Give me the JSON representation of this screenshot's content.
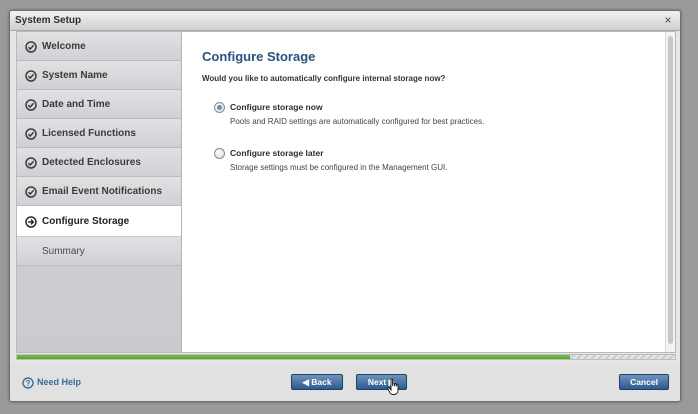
{
  "window": {
    "title": "System Setup",
    "close_glyph": "×"
  },
  "sidebar": {
    "items": [
      {
        "label": "Welcome",
        "icon": "check-circle-icon"
      },
      {
        "label": "System Name",
        "icon": "check-circle-icon"
      },
      {
        "label": "Date and Time",
        "icon": "check-circle-icon"
      },
      {
        "label": "Licensed Functions",
        "icon": "check-circle-icon"
      },
      {
        "label": "Detected Enclosures",
        "icon": "check-circle-icon"
      },
      {
        "label": "Email Event Notifications",
        "icon": "check-circle-icon"
      },
      {
        "label": "Configure Storage",
        "icon": "arrow-circle-icon",
        "active": true
      },
      {
        "label": "Summary"
      }
    ]
  },
  "main": {
    "heading": "Configure Storage",
    "question": "Would you like to automatically configure internal storage now?",
    "options": [
      {
        "label": "Configure storage now",
        "description": "Pools and RAID settings are automatically configured for best practices.",
        "selected": true
      },
      {
        "label": "Configure storage later",
        "description": "Storage settings must be configured in the Management GUI.",
        "selected": false
      }
    ]
  },
  "progress": {
    "fraction": 0.84
  },
  "footer": {
    "help_label": "Need Help",
    "back_label": "◀ Back",
    "next_label": "Next ▶",
    "cancel_label": "Cancel"
  },
  "colors": {
    "accent": "#27537f",
    "button": "#2e5a8e",
    "progress": "#5fb23a"
  }
}
